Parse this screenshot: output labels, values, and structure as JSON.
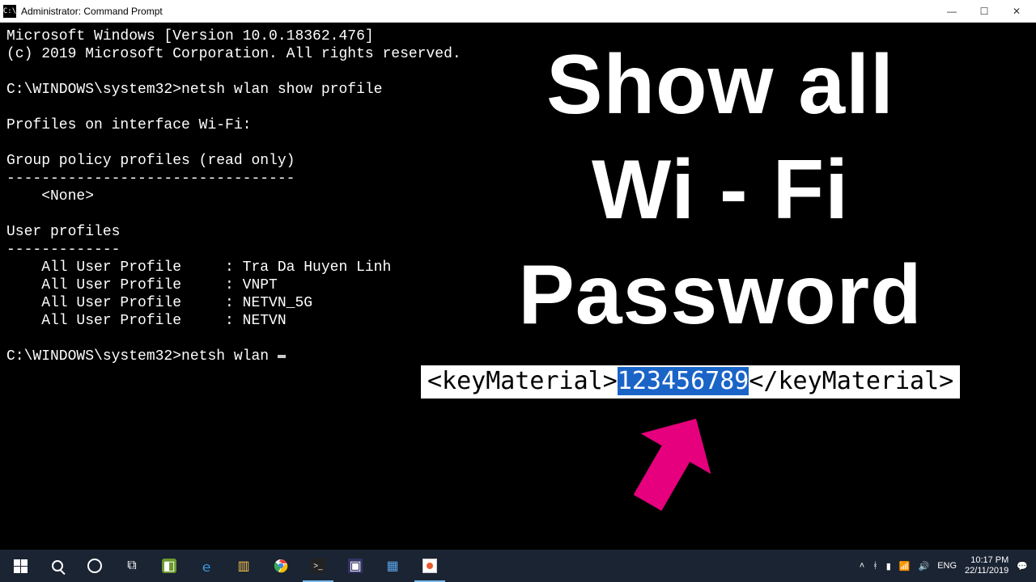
{
  "window": {
    "title": "Administrator: Command Prompt",
    "app_icon_label": "C:\\"
  },
  "terminal": {
    "header1": "Microsoft Windows [Version 10.0.18362.476]",
    "header2": "(c) 2019 Microsoft Corporation. All rights reserved.",
    "prompt_path": "C:\\WINDOWS\\system32>",
    "command1": "netsh wlan show profile",
    "section_interface": "Profiles on interface Wi-Fi:",
    "group_policy_header": "Group policy profiles (read only)",
    "group_policy_sep": "---------------------------------",
    "group_policy_none": "    <None>",
    "user_profiles_header": "User profiles",
    "user_profiles_sep": "-------------",
    "profiles": [
      "    All User Profile     : Tra Da Huyen Linh",
      "    All User Profile     : VNPT",
      "    All User Profile     : NETVN_5G",
      "    All User Profile     : NETVN"
    ],
    "command2": "netsh wlan "
  },
  "overlay": {
    "line1": "Show all",
    "line2": "Wi - Fi",
    "line3": "Password",
    "key_open": "<keyMaterial>",
    "key_value": "123456789",
    "key_close": "</keyMaterial>"
  },
  "taskbar": {
    "lang": "ENG",
    "time": "10:17 PM",
    "date": "22/11/2019"
  }
}
